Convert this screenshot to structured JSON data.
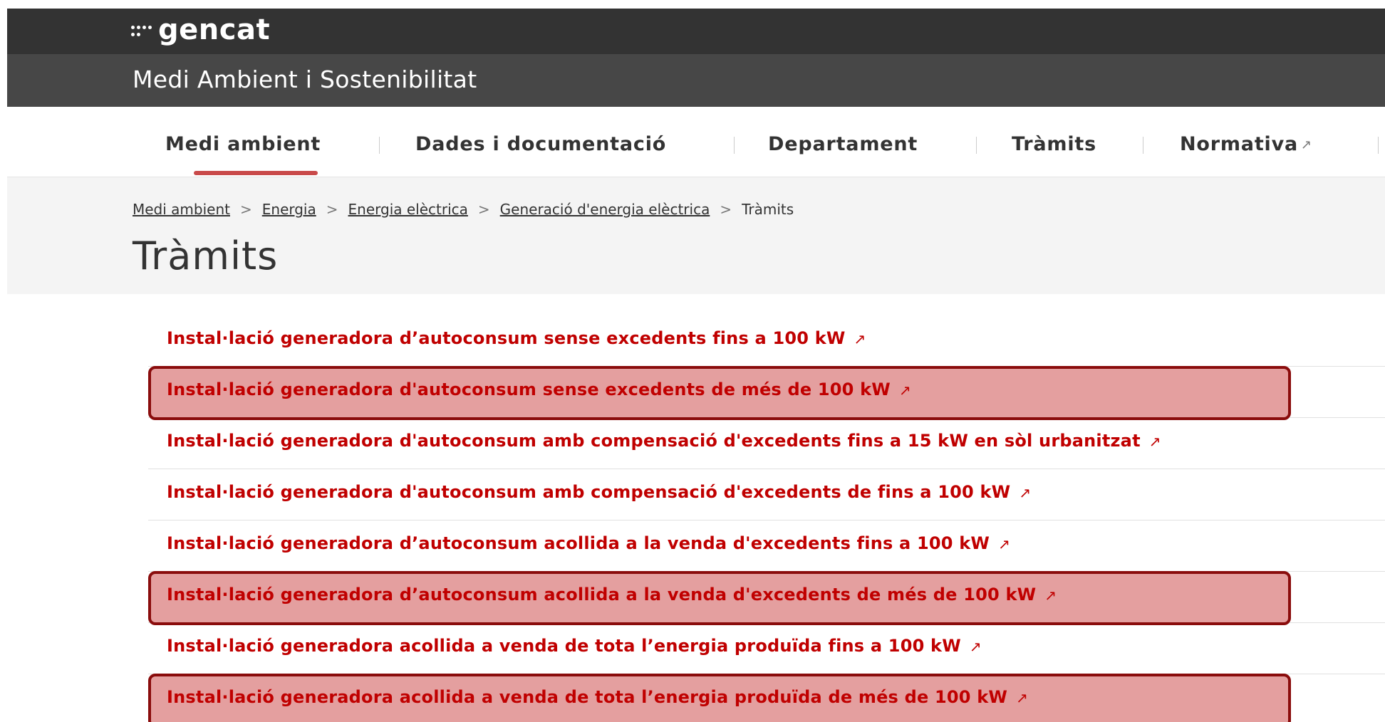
{
  "header": {
    "logo_text": "gencat",
    "department_title": "Medi Ambient i Sostenibilitat"
  },
  "nav": {
    "items": [
      {
        "label": "Medi ambient",
        "active": true
      },
      {
        "label": "Dades i documentació"
      },
      {
        "label": "Departament"
      },
      {
        "label": "Tràmits"
      },
      {
        "label": "Normativa",
        "external": true
      }
    ],
    "external_icon": "external-link-icon"
  },
  "breadcrumb": {
    "items": [
      "Medi ambient",
      "Energia",
      "Energia elèctrica",
      "Generació d'energia elèctrica",
      "Tràmits"
    ],
    "separator": ">"
  },
  "page_title": "Tràmits",
  "procedures": [
    {
      "label": "Instal·lació generadora d’autoconsum sense excedents fins a 100 kW",
      "highlighted": false
    },
    {
      "label": "Instal·lació generadora d'autoconsum sense excedents de més de 100 kW",
      "highlighted": true
    },
    {
      "label": "Instal·lació generadora d'autoconsum amb compensació d'excedents fins a 15 kW en sòl urbanitzat",
      "highlighted": false
    },
    {
      "label": "Instal·lació generadora d'autoconsum amb compensació d'excedents de fins a 100 kW",
      "highlighted": false
    },
    {
      "label": "Instal·lació generadora d’autoconsum acollida a la venda d'excedents fins a 100 kW",
      "highlighted": false
    },
    {
      "label": "Instal·lació generadora d’autoconsum acollida a la venda d'excedents de més de 100 kW",
      "highlighted": true
    },
    {
      "label": "Instal·lació generadora acollida a venda de tota l’energia produïda fins a 100 kW",
      "highlighted": false
    },
    {
      "label": "Instal·lació generadora acollida a venda de tota l’energia produïda de més de 100 kW",
      "highlighted": true
    }
  ],
  "colors": {
    "topbar": "#333333",
    "deptbar": "#474747",
    "link_red": "#c00000",
    "highlight_fill": "#cd5050",
    "highlight_border": "#8a0c0c",
    "active_underline": "#c94a4a"
  }
}
